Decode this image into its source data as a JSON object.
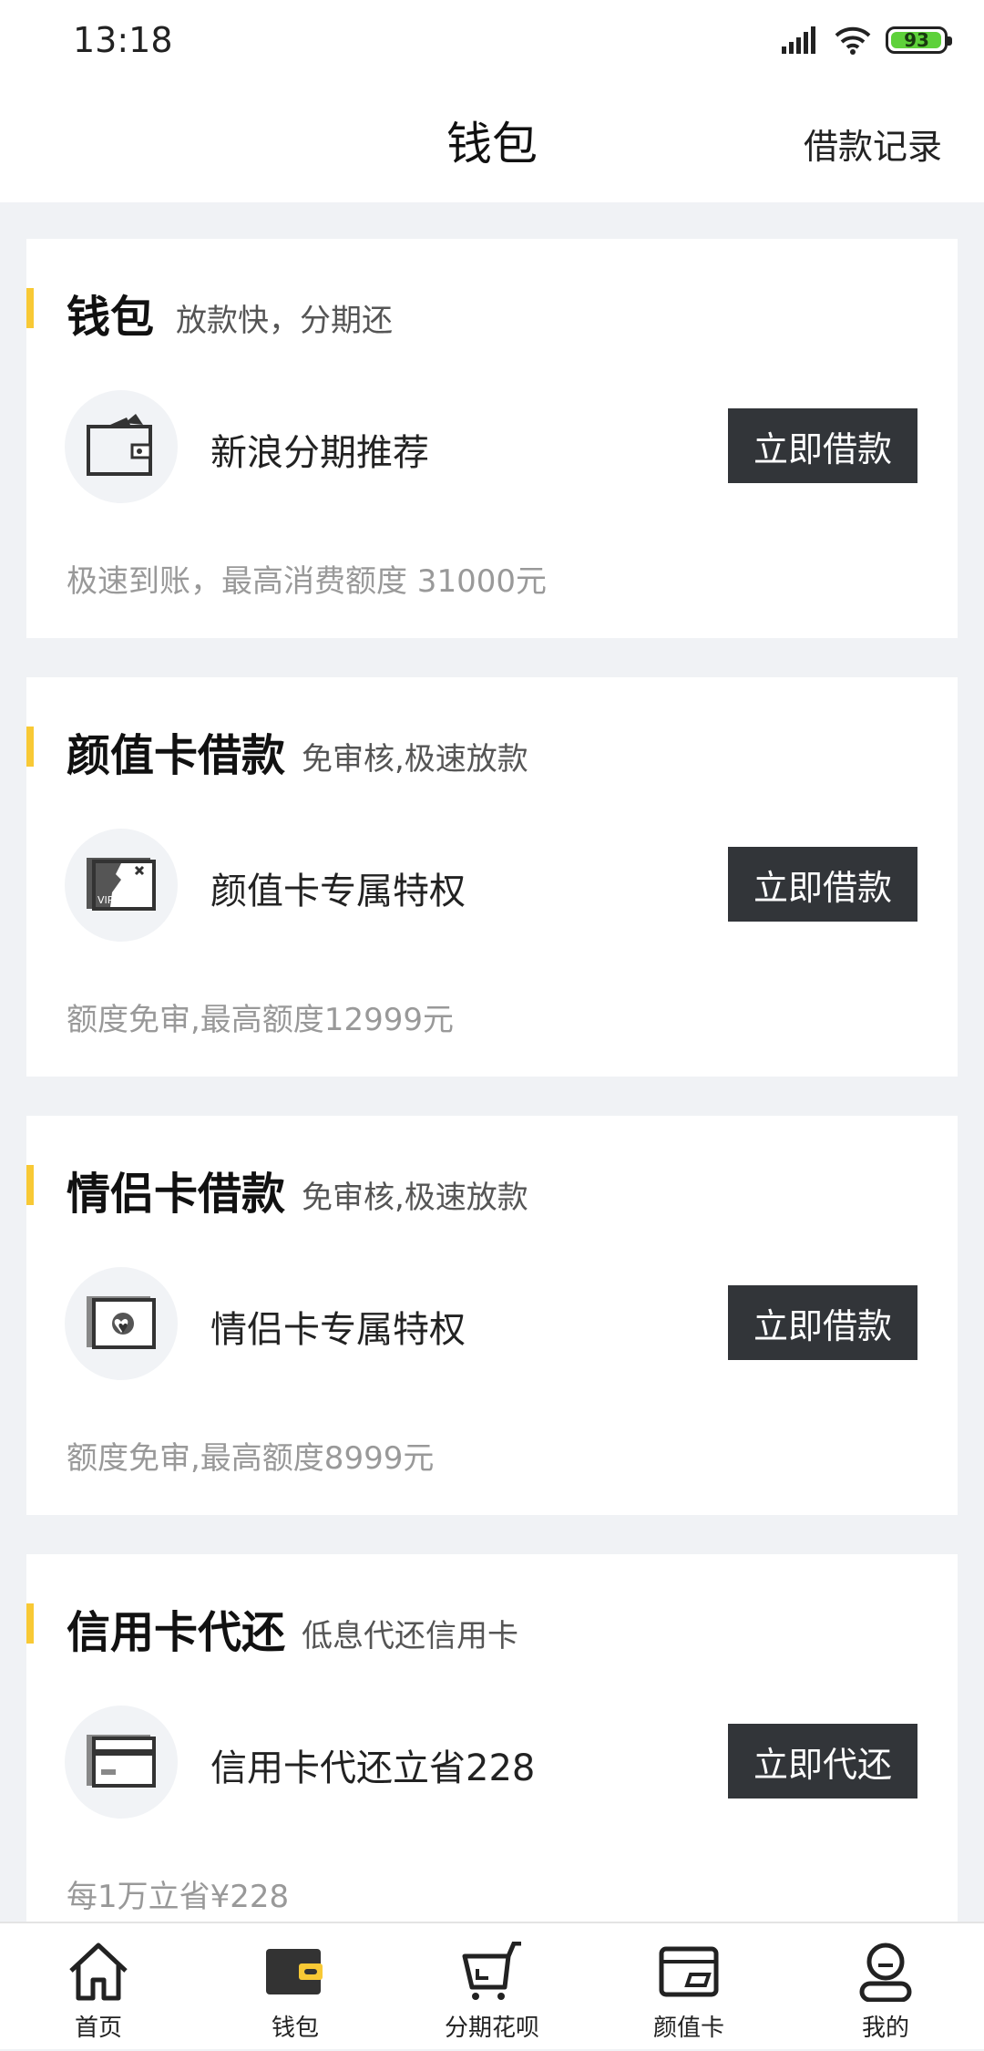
{
  "status_bar": {
    "time": "13:18",
    "battery": "93",
    "icons": [
      "signal-icon",
      "wifi-icon",
      "battery-icon"
    ]
  },
  "nav": {
    "title": "钱包",
    "right_link": "借款记录"
  },
  "cards": [
    {
      "title": "钱包",
      "subtitle": "放款快，分期还",
      "icon": "wallet-icon",
      "item": "新浪分期推荐",
      "button": "立即借款",
      "desc": "极速到账，最高消费额度 31000元"
    },
    {
      "title": "颜值卡借款",
      "subtitle": "免审核,极速放款",
      "icon": "vip-card-icon",
      "item": "颜值卡专属特权",
      "button": "立即借款",
      "desc": "额度免审,最高额度12999元"
    },
    {
      "title": "情侣卡借款",
      "subtitle": "免审核,极速放款",
      "icon": "couple-card-icon",
      "item": "情侣卡专属特权",
      "button": "立即借款",
      "desc": "额度免审,最高额度8999元"
    },
    {
      "title": "信用卡代还",
      "subtitle": "低息代还信用卡",
      "icon": "credit-card-icon",
      "item": "信用卡代还立省228",
      "button": "立即代还",
      "desc": "每1万立省¥228"
    }
  ],
  "tabs": [
    {
      "label": "首页",
      "icon": "home-icon"
    },
    {
      "label": "钱包",
      "icon": "wallet-icon",
      "active": true
    },
    {
      "label": "分期花呗",
      "icon": "cart-icon"
    },
    {
      "label": "颜值卡",
      "icon": "card-icon"
    },
    {
      "label": "我的",
      "icon": "profile-icon"
    }
  ],
  "colors": {
    "accent": "#f8c935",
    "button_bg": "#323539",
    "page_bg": "#f0f2f5"
  }
}
